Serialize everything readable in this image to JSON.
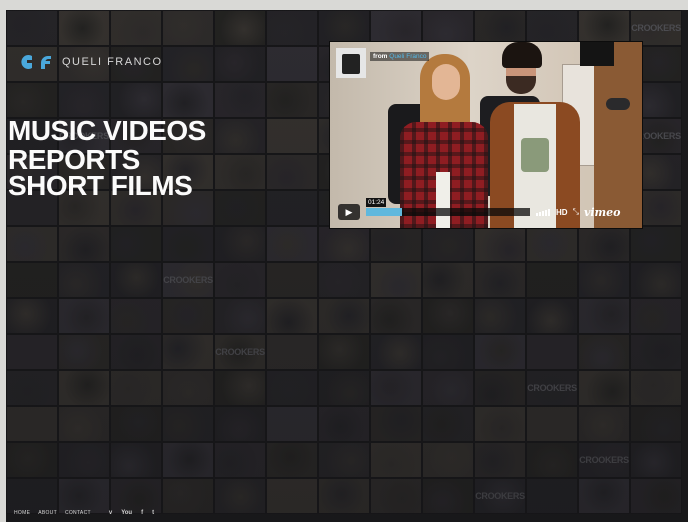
{
  "brand": {
    "name": "QUELI FRANCO",
    "accent_color": "#4aa8db"
  },
  "hero": {
    "lines": [
      "MUSIC VIDEOS",
      "REPORTS",
      "SHORT FILMS"
    ]
  },
  "player": {
    "source_prefix": "from",
    "source_name": "Queli Franco",
    "timecode": "01:24",
    "progress": 0.22,
    "hd_label": "HD",
    "fullscreen_glyph": "⤡",
    "vimeo_label": "vimeo",
    "play_glyph": "▶"
  },
  "mosaic": {
    "tile_label": "CROOKERS"
  },
  "footer": {
    "nav": [
      "HOME",
      "ABOUT",
      "CONTACT"
    ],
    "social": [
      {
        "name": "vimeo-icon",
        "glyph": "v"
      },
      {
        "name": "youtube-icon",
        "glyph": "You"
      },
      {
        "name": "facebook-icon",
        "glyph": "f"
      },
      {
        "name": "twitter-icon",
        "glyph": "t"
      }
    ]
  }
}
